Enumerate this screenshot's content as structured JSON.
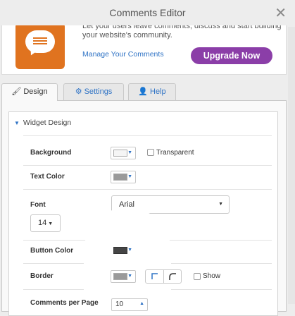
{
  "window": {
    "title": "Comments Editor",
    "close_glyph": "✕"
  },
  "promo": {
    "description": "Let your users leave comments, discuss and start building your website's community.",
    "manage_link": "Manage Your Comments",
    "upgrade_button": "Upgrade Now",
    "icon": "comment-bubble-icon",
    "icon_color": "#e0731f",
    "upgrade_color": "#8b3ea8"
  },
  "tabs": [
    {
      "label": "Design",
      "icon": "brush-icon",
      "active": true
    },
    {
      "label": "Settings",
      "icon": "gear-icon",
      "active": false
    },
    {
      "label": "Help",
      "icon": "user-icon",
      "active": false
    }
  ],
  "section": {
    "title": "Widget Design"
  },
  "settings": {
    "background_label": "Background",
    "background_color": "#f5f5f5",
    "transparent_label": "Transparent",
    "transparent_checked": false,
    "text_color_label": "Text Color",
    "text_color": "#9a9a9a",
    "font_label": "Font",
    "font_value": "Arial",
    "font_size": "14",
    "button_color_label": "Button Color",
    "button_color": "#454545",
    "border_label": "Border",
    "border_color": "#9a9a9a",
    "border_show_label": "Show",
    "border_show_checked": false,
    "comments_per_page_label": "Comments per Page",
    "comments_per_page_value": "10"
  },
  "accent_color": "#2f73c5"
}
